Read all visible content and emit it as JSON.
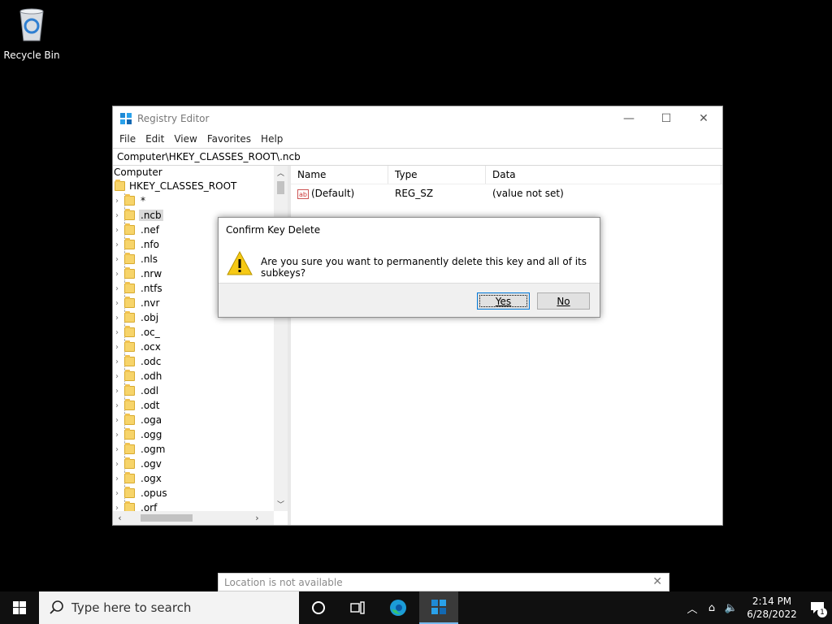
{
  "desktop": {
    "recycle_bin_label": "Recycle Bin"
  },
  "window": {
    "title": "Registry Editor",
    "controls": {
      "minimize": "—",
      "maximize": "☐",
      "close": "✕"
    },
    "menu": [
      "File",
      "Edit",
      "View",
      "Favorites",
      "Help"
    ],
    "address": "Computer\\HKEY_CLASSES_ROOT\\.ncb",
    "tree": {
      "root_label": "Computer",
      "hive_label": "HKEY_CLASSES_ROOT",
      "items": [
        "*",
        ".ncb",
        ".nef",
        ".nfo",
        ".nls",
        ".nrw",
        ".ntfs",
        ".nvr",
        ".obj",
        ".oc_",
        ".ocx",
        ".odc",
        ".odh",
        ".odl",
        ".odt",
        ".oga",
        ".ogg",
        ".ogm",
        ".ogv",
        ".ogx",
        ".opus",
        ".orf"
      ],
      "selected": ".ncb"
    },
    "list": {
      "columns": [
        "Name",
        "Type",
        "Data"
      ],
      "rows": [
        {
          "name": "(Default)",
          "type": "REG_SZ",
          "data": "(value not set)"
        }
      ]
    }
  },
  "dialog": {
    "title": "Confirm Key Delete",
    "message": "Are you sure you want to permanently delete this key and all of its subkeys?",
    "yes_label": "Yes",
    "no_label": "No"
  },
  "notification": {
    "text": "Location is not available"
  },
  "taskbar": {
    "search_placeholder": "Type here to search",
    "time": "2:14 PM",
    "date": "6/28/2022",
    "notification_count": "1"
  },
  "colors": {
    "accent": "#0078d7",
    "folder": "#f7d46a",
    "warning": "#f6c915"
  }
}
